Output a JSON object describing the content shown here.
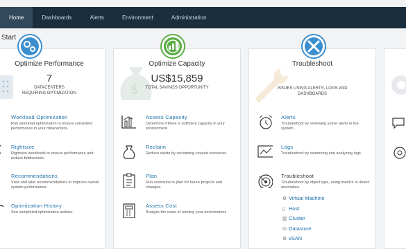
{
  "nav": [
    "Home",
    "Dashboards",
    "Alerts",
    "Environment",
    "Administration"
  ],
  "start_label": "Start",
  "performance": {
    "title": "Optimize Performance",
    "value": "7",
    "sub": "DATACENTERS\nREQUIRING OPTIMIZATION",
    "items": [
      {
        "title": "Workload Optimization",
        "desc": "Run workload optimization to ensure consistent performance in your datacenters."
      },
      {
        "title": "Rightsize",
        "desc": "Rightsize workloads to ensure performance and reduce bottlenecks."
      },
      {
        "title": "Recommendations",
        "desc": "View and take recommendations to improve overall system performance."
      },
      {
        "title": "Optimization History",
        "desc": "See completed optimization actions."
      }
    ]
  },
  "capacity": {
    "title": "Optimize Capacity",
    "value": "US$15,859",
    "sub": "TOTAL SAVINGS OPPORTUNITY",
    "items": [
      {
        "title": "Assess Capacity",
        "desc": "Determine if there is sufficient capacity in your environment."
      },
      {
        "title": "Reclaim",
        "desc": "Reduce waste by reclaiming unused resources."
      },
      {
        "title": "Plan",
        "desc": "Run scenarios to plan for future projects and changes."
      },
      {
        "title": "Assess Cost",
        "desc": "Analyze the costs of running your environment."
      }
    ]
  },
  "troubleshoot": {
    "title": "Troubleshoot",
    "sub": "ISSUES USING ALERTS, LOGS AND\nDASHBOARDS",
    "items": [
      {
        "title": "Alerts",
        "desc": "Troubleshoot by reviewing active alerts in the system."
      },
      {
        "title": "Logs",
        "desc": "Troubleshoot by examining and analyzing logs."
      },
      {
        "title": "Troubleshoot",
        "desc": "Troubleshoot by object type, using metrics to detect anomalies."
      }
    ],
    "objects": [
      "Virtual Machine",
      "Host",
      "Cluster",
      "Datastore",
      "vSAN"
    ]
  },
  "colors": {
    "nav_bg": "#1a2e3e",
    "nav_active": "#32495b",
    "link": "#1b6ea8",
    "badge_blue": "#3b8fcf",
    "badge_green": "#5aac44"
  }
}
